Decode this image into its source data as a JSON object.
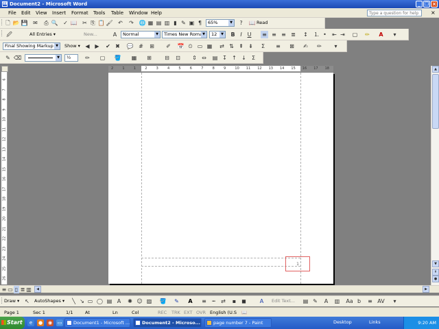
{
  "window": {
    "title": "Document2 - Microsoft Word",
    "app_icon": "W"
  },
  "menu": {
    "items": [
      "File",
      "Edit",
      "View",
      "Insert",
      "Format",
      "Tools",
      "Table",
      "Window",
      "Help"
    ],
    "help_placeholder": "Type a question for help",
    "doc_close": "×"
  },
  "standard_toolbar": {
    "zoom": "65%",
    "read_label": "Read"
  },
  "header_footer_toolbar": {
    "autotext": "All Entries ▾",
    "new_label": "New...",
    "style": "Normal",
    "font": "Times New Roman",
    "size": "12"
  },
  "reviewing_toolbar": {
    "display": "Final Showing Markup",
    "show_label": "Show ▾"
  },
  "drawing_toolbar": {
    "line_weight": "½",
    "draw_label": "Draw ▾",
    "autoshapes_label": "AutoShapes ▾",
    "edit_text_label": "Edit Text..."
  },
  "ruler": {
    "h_ticks": [
      "2",
      "1",
      "1",
      "2",
      "3",
      "4",
      "5",
      "6",
      "7",
      "8",
      "9",
      "10",
      "11",
      "12",
      "13",
      "14",
      "15",
      "16",
      "17",
      "18"
    ],
    "v_ticks": [
      "6",
      "7",
      "8",
      "9",
      "10",
      "11",
      "12",
      "13",
      "14",
      "15",
      "16",
      "17",
      "18",
      "19",
      "20",
      "21",
      "22",
      "23",
      "24",
      "25",
      "26"
    ]
  },
  "document": {
    "page_number_text": "1"
  },
  "statusbar": {
    "page": "Page 1",
    "sec": "Sec 1",
    "pages": "1/1",
    "at": "At",
    "ln": "Ln",
    "col": "Col",
    "rec": "REC",
    "trk": "TRK",
    "ext": "EXT",
    "ovr": "OVR",
    "language": "English (U.S"
  },
  "taskbar": {
    "start": "Start",
    "tasks": [
      "Document1 - Microsoft ...",
      "Document2 - Microso...",
      "page number 7 - Paint"
    ],
    "desktop": "Desktop",
    "links": "Links",
    "clock": "9:20 AM"
  }
}
